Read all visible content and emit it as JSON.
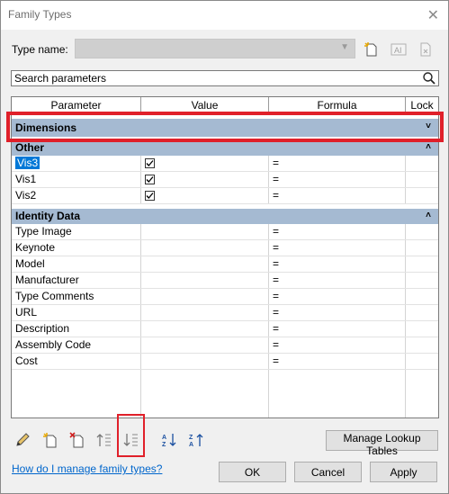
{
  "window": {
    "title": "Family Types"
  },
  "type_name": {
    "label": "Type name:",
    "value": ""
  },
  "search": {
    "placeholder": "Search parameters"
  },
  "columns": [
    "Parameter",
    "Value",
    "Formula",
    "Lock"
  ],
  "groups": [
    {
      "name": "Dimensions",
      "collapsed": true,
      "rows": []
    },
    {
      "name": "Other",
      "collapsed": false,
      "rows": [
        {
          "param": "Vis3",
          "value": "checked",
          "formula": "=",
          "selected": true
        },
        {
          "param": "Vis1",
          "value": "checked",
          "formula": "="
        },
        {
          "param": "Vis2",
          "value": "checked",
          "formula": "="
        }
      ]
    },
    {
      "name": "Identity Data",
      "collapsed": false,
      "rows": [
        {
          "param": "Type Image",
          "value": "",
          "formula": "="
        },
        {
          "param": "Keynote",
          "value": "",
          "formula": "="
        },
        {
          "param": "Model",
          "value": "",
          "formula": "="
        },
        {
          "param": "Manufacturer",
          "value": "",
          "formula": "="
        },
        {
          "param": "Type Comments",
          "value": "",
          "formula": "="
        },
        {
          "param": "URL",
          "value": "",
          "formula": "="
        },
        {
          "param": "Description",
          "value": "",
          "formula": "="
        },
        {
          "param": "Assembly Code",
          "value": "",
          "formula": "="
        },
        {
          "param": "Cost",
          "value": "",
          "formula": "="
        }
      ]
    }
  ],
  "toolbar_icons": [
    "edit-parameter-icon",
    "new-parameter-icon",
    "delete-parameter-icon",
    "move-up-icon",
    "move-down-icon",
    "sort-ascending-icon",
    "sort-descending-icon"
  ],
  "buttons": {
    "manage_lookup": "Manage Lookup Tables",
    "ok": "OK",
    "cancel": "Cancel",
    "apply": "Apply"
  },
  "help_link": "How do I manage family types?",
  "colors": {
    "group_header": "#a5bad2",
    "selection": "#0078d7",
    "highlight": "#e0202a",
    "link": "#0066cc"
  }
}
